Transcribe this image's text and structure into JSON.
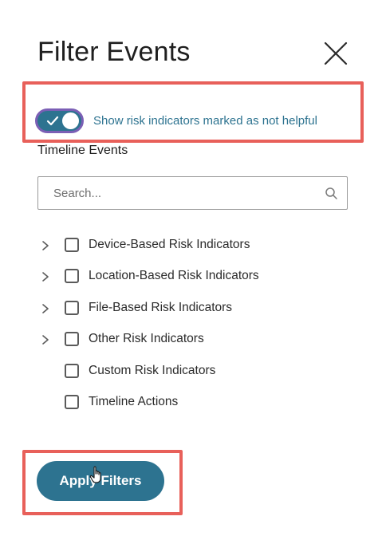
{
  "header": {
    "title": "Filter Events",
    "close_icon": "close-icon"
  },
  "toggle": {
    "label": "Show risk indicators marked as not helpful",
    "checked": true
  },
  "timeline": {
    "section_label": "Timeline Events",
    "search": {
      "placeholder": "Search...",
      "value": ""
    },
    "items": [
      {
        "label": "Device-Based Risk Indicators",
        "expandable": true,
        "checked": false
      },
      {
        "label": "Location-Based Risk Indicators",
        "expandable": true,
        "checked": false
      },
      {
        "label": "File-Based Risk Indicators",
        "expandable": true,
        "checked": false
      },
      {
        "label": "Other Risk Indicators",
        "expandable": true,
        "checked": false
      },
      {
        "label": "Custom Risk Indicators",
        "expandable": false,
        "checked": false
      },
      {
        "label": "Timeline Actions",
        "expandable": false,
        "checked": false
      }
    ]
  },
  "footer": {
    "apply_label": "Apply Filters"
  },
  "colors": {
    "accent": "#2d7390",
    "highlight": "#e8605a",
    "toggle_border": "#7b5fb5"
  }
}
